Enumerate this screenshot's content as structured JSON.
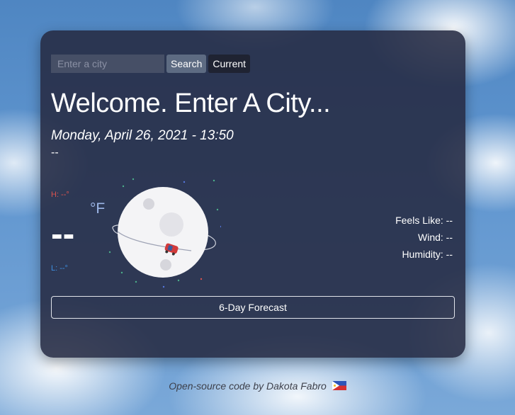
{
  "search": {
    "placeholder": "Enter a city",
    "search_label": "Search",
    "current_label": "Current"
  },
  "main": {
    "title": "Welcome. Enter A City...",
    "date": "Monday, April 26, 2021 - 13:50",
    "description": "--",
    "high": "H: --°",
    "low": "L: --°",
    "temperature": "--",
    "unit": "°F"
  },
  "stats": {
    "feels_like": "Feels Like: --",
    "wind": "Wind: --",
    "humidity": "Humidity: --"
  },
  "forecast_button": "6-Day Forecast",
  "footer": {
    "text": "Open-source code by Dakota Fabro",
    "flag_icon": "philippines-flag-icon"
  },
  "colors": {
    "card_bg": "#262a42",
    "high": "#d9534f",
    "low": "#3d8fe0",
    "unit": "#9db7e8",
    "search_btn": "#5d6b82"
  }
}
